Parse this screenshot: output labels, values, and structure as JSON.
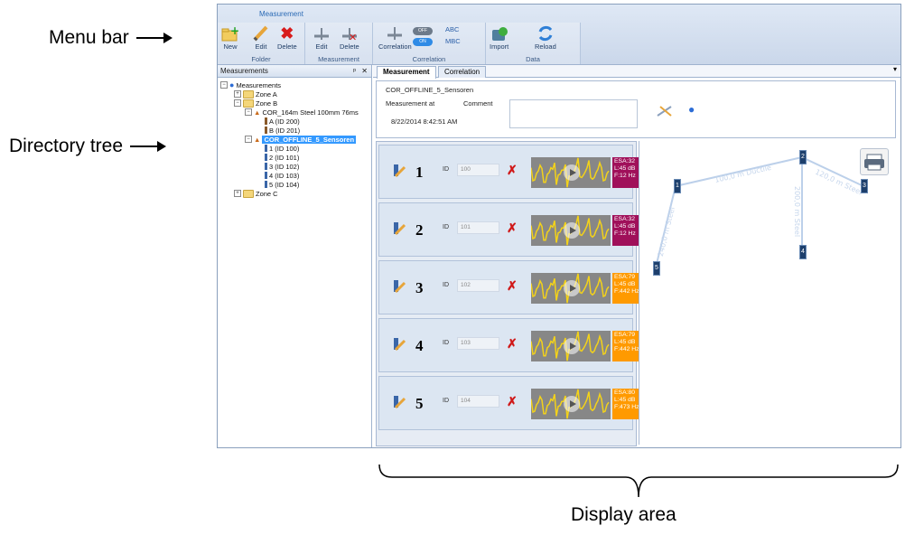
{
  "annotations": {
    "menu_bar": "Menu bar",
    "directory_tree": "Directory tree",
    "display_area": "Display area"
  },
  "ribbon": {
    "tab": "Measurement",
    "folder": {
      "label": "Folder",
      "new": "New",
      "edit": "Edit",
      "delete": "Delete"
    },
    "measurement": {
      "label": "Measurement",
      "edit": "Edit",
      "delete": "Delete"
    },
    "correlation": {
      "label": "Correlation",
      "correlation": "Correlation",
      "toggle_off": "OFF",
      "toggle_on": "ON",
      "abc": "ABC",
      "mbc": "MBC"
    },
    "data": {
      "label": "Data",
      "import": "Import",
      "reload": "Reload"
    }
  },
  "tree": {
    "pane_title": "Measurements",
    "pin": "ᵖ",
    "close": "✕",
    "root": "Measurements",
    "zone_a": "Zone A",
    "zone_b": "Zone B",
    "cor1": "COR_164m Steel 100mm 76ms",
    "a": "A (ID 200)",
    "b": "B (ID 201)",
    "cor2": "COR_OFFLINE_5_Sensoren",
    "s1": "1 (ID 100)",
    "s2": "2 (ID 101)",
    "s3": "3 (ID 102)",
    "s4": "4 (ID 103)",
    "s5": "5 (ID 104)",
    "zone_c": "Zone C"
  },
  "main": {
    "tabs": [
      "Measurement",
      "Correlation"
    ],
    "title": "COR_OFFLINE_5_Sensoren",
    "measured_label": "Measurement at",
    "comment_label": "Comment",
    "measured_at": "8/22/2014 8:42:51 AM",
    "comment": ""
  },
  "sensors": [
    {
      "num": "1",
      "id_label": "ID",
      "id": "100",
      "esa": "ESA:32",
      "level": "L:45 dB",
      "freq": "F:12 Hz",
      "color": "#a0105a"
    },
    {
      "num": "2",
      "id_label": "ID",
      "id": "101",
      "esa": "ESA:32",
      "level": "L:45 dB",
      "freq": "F:12 Hz",
      "color": "#a0105a"
    },
    {
      "num": "3",
      "id_label": "ID",
      "id": "102",
      "esa": "ESA:79",
      "level": "L:45 dB",
      "freq": "F:442 Hz",
      "color": "#ff9a00"
    },
    {
      "num": "4",
      "id_label": "ID",
      "id": "103",
      "esa": "ESA:79",
      "level": "L:45 dB",
      "freq": "F:442 Hz",
      "color": "#ff9a00"
    },
    {
      "num": "5",
      "id_label": "ID",
      "id": "104",
      "esa": "ESA:80",
      "level": "L:45 dB",
      "freq": "F:473 Hz",
      "color": "#ff9a00"
    }
  ],
  "map": {
    "pipes": [
      "100,0 m Ductile",
      "120,0 m Steel",
      "200,0 m Steel",
      "240,0 m Steel"
    ],
    "markers": [
      "1",
      "2",
      "3",
      "4",
      "5"
    ]
  }
}
